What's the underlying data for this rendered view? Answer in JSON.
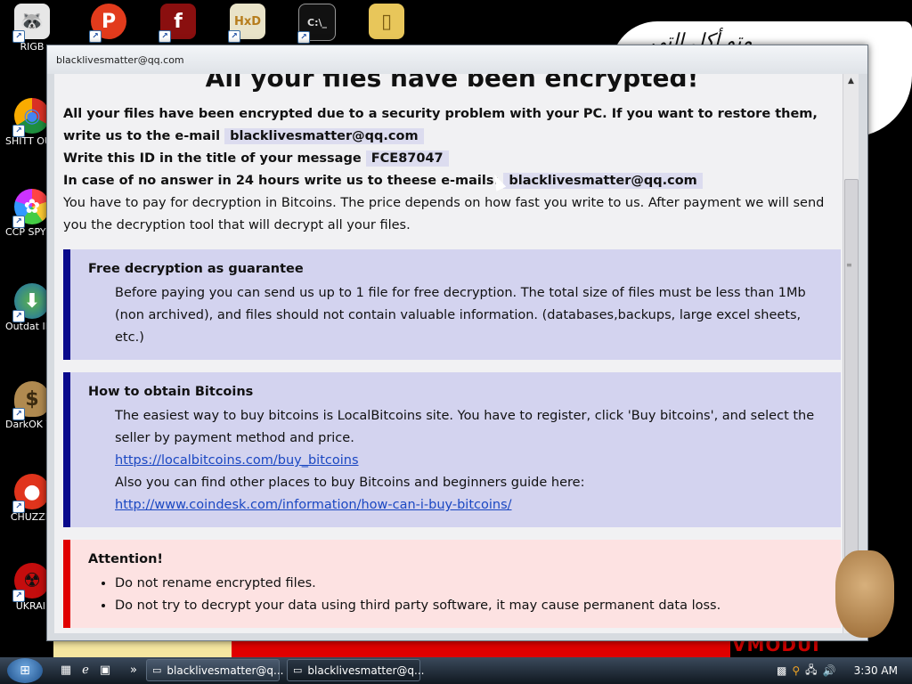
{
  "desktop": {
    "icons": [
      {
        "label": "RIGB",
        "glyph": "🦝"
      },
      {
        "label": "SHITT OUTDA",
        "glyph": "◉"
      },
      {
        "label": "CCP SPYWA",
        "glyph": "✿"
      },
      {
        "label": "Outdat IDM Crac",
        "glyph": "⬇"
      },
      {
        "label": "DarkOK V Game",
        "glyph": "$"
      },
      {
        "label": "CHUZZLI",
        "glyph": "●"
      },
      {
        "label": "UKRAII",
        "glyph": "☢"
      }
    ],
    "top_icons": [
      {
        "glyph": "P"
      },
      {
        "glyph": "f"
      },
      {
        "glyph": "HxD"
      },
      {
        "glyph": "C:\\_"
      },
      {
        "glyph": "▯"
      }
    ],
    "wallpaper_text": "متو أكل التي",
    "wallpaper_brand": "VMODUI"
  },
  "window": {
    "title": "blacklivesmatter@qq.com",
    "heading": "All your files have been encrypted!",
    "intro_1": "All your files have been encrypted due to a security problem with your PC. If you want to restore them, write us to the e-mail",
    "email": "blacklivesmatter@qq.com",
    "id_label": "Write this ID in the title of your message",
    "id_value": "FCE87047",
    "noanswer_label": "In case of no answer in 24 hours write us to theese e-mails:",
    "noanswer_email": "blacklivesmatter@qq.com",
    "payment_text": "You have to pay for decryption in Bitcoins. The price depends on how fast you write to us. After payment we will send you the decryption tool that will decrypt all your files.",
    "free_box": {
      "title": "Free decryption as guarantee",
      "body": "Before paying you can send us up to 1 file for free decryption. The total size of files must be less than 1Mb (non archived), and files should not contain valuable information. (databases,backups, large excel sheets, etc.)"
    },
    "bitcoin_box": {
      "title": "How to obtain Bitcoins",
      "body": "The easiest way to buy bitcoins is LocalBitcoins site. You have to register, click 'Buy bitcoins', and select the seller by payment method and price.",
      "link_1": "https://localbitcoins.com/buy_bitcoins",
      "body_2": "Also you can find other places to buy Bitcoins and beginners guide here:",
      "link_2": "http://www.coindesk.com/information/how-can-i-buy-bitcoins/"
    },
    "attention_box": {
      "title": "Attention!",
      "items": [
        "Do not rename encrypted files.",
        "Do not try to decrypt your data using third party software, it may cause permanent data loss."
      ]
    }
  },
  "taskbar": {
    "buttons": [
      {
        "label": "blacklivesmatter@q..."
      },
      {
        "label": "blacklivesmatter@q..."
      }
    ],
    "clock": "3:30 AM"
  },
  "colors": {
    "box_accent": "#0a0a8c",
    "box_bg": "#d3d3ef",
    "attention_accent": "#e00000",
    "attention_bg": "#fde2e2",
    "link": "#1a47c2"
  }
}
